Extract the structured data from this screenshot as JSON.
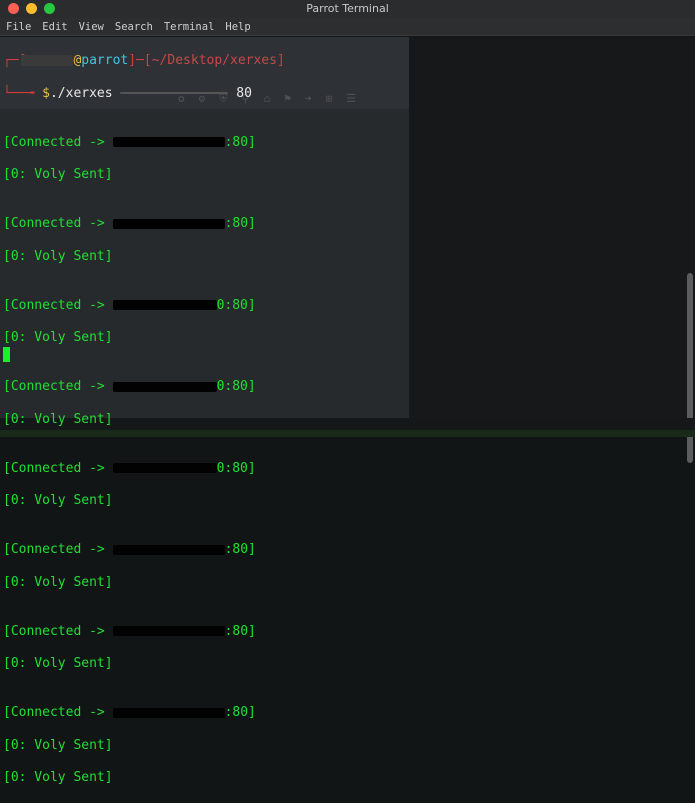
{
  "window": {
    "title": "Parrot Terminal"
  },
  "menu": {
    "items": [
      "File",
      "Edit",
      "View",
      "Search",
      "Terminal",
      "Help"
    ]
  },
  "prompt": {
    "bracket_open": "┌─[",
    "user": "      ",
    "at": "@",
    "host": "parrot",
    "sep": "]─[",
    "path": "~/Desktop/xerxes",
    "bracket_close": "]",
    "line2_prefix": "└──╼ ",
    "dollar": "$",
    "command": "./xerxes",
    "port": "80"
  },
  "output": {
    "connected_prefix": "[Connected -> ",
    "connected_suffix_plain": ":80]",
    "connected_suffix_0": "0:80]",
    "voly": "[0: Voly Sent]"
  },
  "colors": {
    "accent_green": "#1fe032",
    "prompt_red": "#d43c3c",
    "host_cyan": "#41c7df"
  }
}
